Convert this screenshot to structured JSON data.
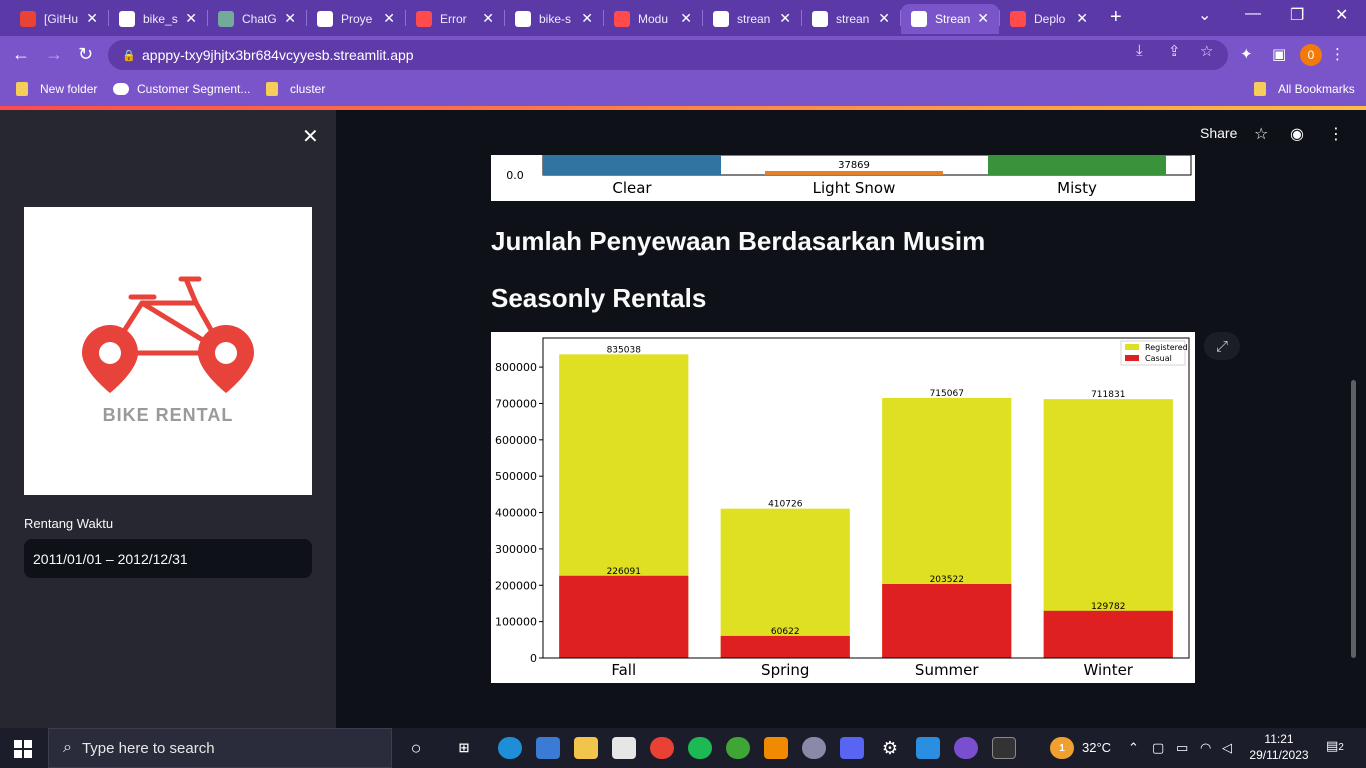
{
  "browser": {
    "tabs": [
      {
        "label": "[GitHu",
        "icon": "gmail-icon",
        "color": "#ea4335"
      },
      {
        "label": "bike_s",
        "icon": "github-icon",
        "color": "#ffffff"
      },
      {
        "label": "ChatG",
        "icon": "chatgpt-icon",
        "color": "#74aa9c"
      },
      {
        "label": "Proye",
        "icon": "nine-icon",
        "color": "#ffffff"
      },
      {
        "label": "Error",
        "icon": "streamlit-icon",
        "color": "#ff4b4b"
      },
      {
        "label": "bike-s",
        "icon": "github-icon",
        "color": "#ffffff"
      },
      {
        "label": "Modu",
        "icon": "streamlit-icon",
        "color": "#ff4b4b"
      },
      {
        "label": "strean",
        "icon": "streamlit-icon",
        "color": "#ffffff"
      },
      {
        "label": "strean",
        "icon": "streamlit-icon",
        "color": "#ffffff"
      },
      {
        "label": "Strean",
        "icon": "streamlit-icon",
        "color": "#ffffff",
        "active": true
      },
      {
        "label": "Deplo",
        "icon": "streamlit-icon",
        "color": "#ff4b4b"
      }
    ],
    "url": "apppy-txy9jhjtx3br684vcyyesb.streamlit.app",
    "profile_initial": "0",
    "bookmarks": {
      "items": [
        "New folder",
        "Customer Segment...",
        "cluster"
      ],
      "all": "All Bookmarks"
    }
  },
  "sidebar": {
    "logo_text": "BIKE RENTAL",
    "date_range_label": "Rentang Waktu",
    "date_range_value": "2011/01/01 – 2012/12/31"
  },
  "header": {
    "share_label": "Share"
  },
  "weather_chart_partial": {
    "ytick": "0.0",
    "categories": [
      "Clear",
      "Light Snow",
      "Misty"
    ],
    "light_snow_value": "37869"
  },
  "section": {
    "heading": "Jumlah Penyewaan Berdasarkan Musim",
    "subheading": "Seasonly Rentals"
  },
  "chart_data": {
    "type": "bar",
    "stacking": "overlaid",
    "categories": [
      "Fall",
      "Spring",
      "Summer",
      "Winter"
    ],
    "series": [
      {
        "name": "Registered",
        "color": "#dfe021",
        "values": [
          835038,
          410726,
          715067,
          711831
        ]
      },
      {
        "name": "Casual",
        "color": "#df2020",
        "values": [
          226091,
          60622,
          203522,
          129782
        ]
      }
    ],
    "yticks": [
      "0",
      "100000",
      "200000",
      "300000",
      "400000",
      "500000",
      "600000",
      "700000",
      "800000"
    ],
    "ylim": [
      0,
      880000
    ],
    "legend_position": "top-right",
    "grid": false
  },
  "taskbar": {
    "search_placeholder": "Type here to search",
    "temperature": "32°C",
    "time": "11:21",
    "date": "29/11/2023",
    "notifications": "2",
    "weather_badge": "1"
  }
}
